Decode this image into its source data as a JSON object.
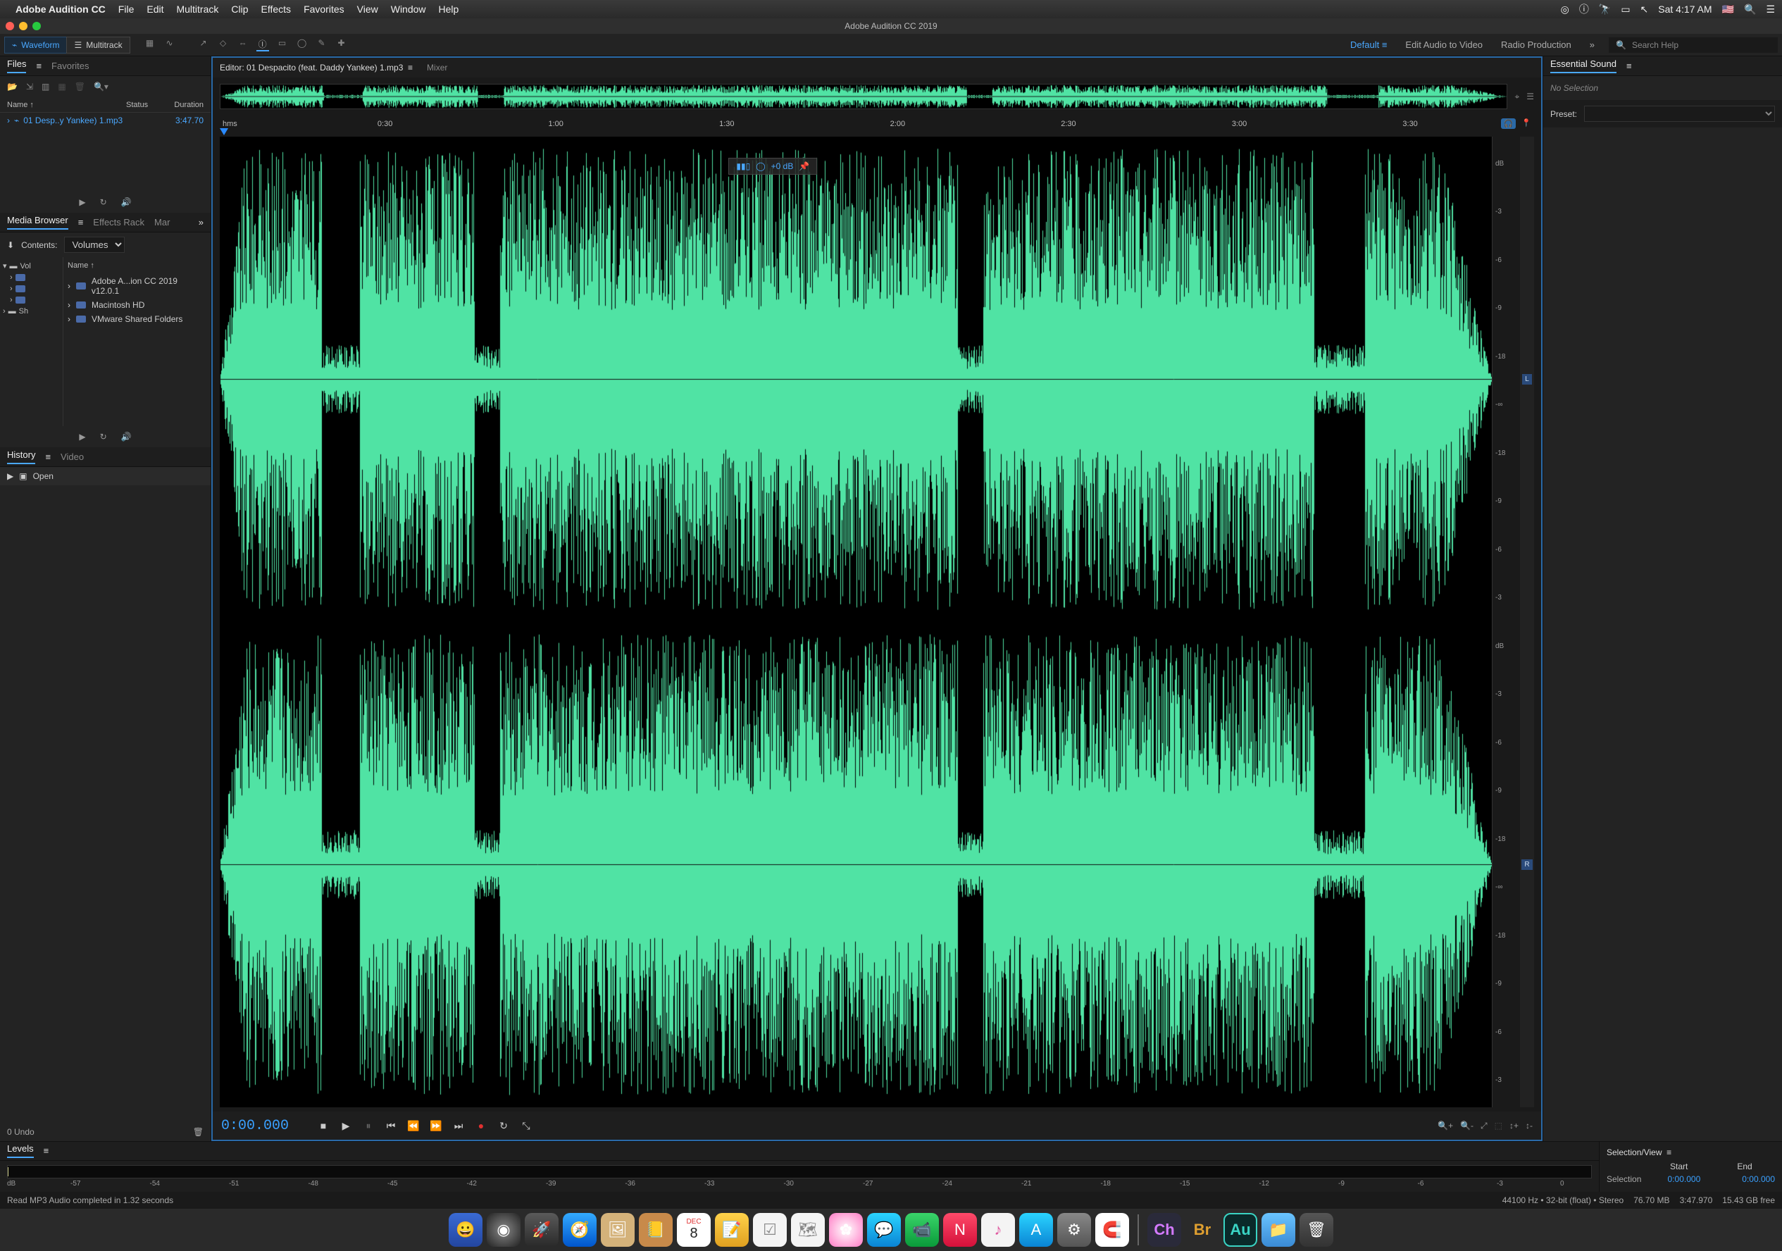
{
  "menubar": {
    "appname": "Adobe Audition CC",
    "items": [
      "File",
      "Edit",
      "Multitrack",
      "Clip",
      "Effects",
      "Favorites",
      "View",
      "Window",
      "Help"
    ],
    "clock": "Sat 4:17 AM"
  },
  "window": {
    "title": "Adobe Audition CC 2019"
  },
  "toolbar": {
    "waveform": "Waveform",
    "multitrack": "Multitrack",
    "workspaces": {
      "default": "Default",
      "edit_av": "Edit Audio to Video",
      "radio": "Radio Production"
    },
    "search_placeholder": "Search Help"
  },
  "files_panel": {
    "tab_files": "Files",
    "tab_fav": "Favorites",
    "cols": {
      "name": "Name ↑",
      "status": "Status",
      "duration": "Duration"
    },
    "rows": [
      {
        "name": "01 Desp..y Yankee) 1.mp3",
        "duration": "3:47.70"
      }
    ]
  },
  "media_browser": {
    "tab_mb": "Media Browser",
    "tab_fx": "Effects Rack",
    "tab_mar": "Mar",
    "contents_label": "Contents:",
    "contents_value": "Volumes",
    "tree_root": "Vol",
    "tree_sh": "Sh",
    "list_hdr": "Name ↑",
    "items": [
      "Adobe A...ion CC 2019 v12.0.1",
      "Macintosh HD",
      "VMware Shared Folders"
    ]
  },
  "history": {
    "tab_history": "History",
    "tab_video": "Video",
    "open": "Open",
    "undo": "0 Undo"
  },
  "editor": {
    "tab_editor": "Editor: 01 Despacito (feat. Daddy Yankee) 1.mp3",
    "tab_mixer": "Mixer",
    "hud_gain": "+0 dB",
    "timeline_hms": "hms",
    "timeline_ticks": [
      "0:30",
      "1:00",
      "1:30",
      "2:00",
      "2:30",
      "3:00",
      "3:30"
    ],
    "db_marks": [
      "dB",
      "-3",
      "-6",
      "-9",
      "-18",
      "-∞",
      "-18",
      "-9",
      "-6",
      "-3"
    ],
    "ch_left": "L",
    "ch_right": "R",
    "timecode": "0:00.000"
  },
  "essential_sound": {
    "title": "Essential Sound",
    "nosel": "No Selection",
    "preset_label": "Preset:"
  },
  "levels": {
    "title": "Levels",
    "db_label": "dB",
    "ticks": [
      "-57",
      "-54",
      "-51",
      "-48",
      "-45",
      "-42",
      "-39",
      "-36",
      "-33",
      "-30",
      "-27",
      "-24",
      "-21",
      "-18",
      "-15",
      "-12",
      "-9",
      "-6",
      "-3",
      "0"
    ]
  },
  "selview": {
    "title": "Selection/View",
    "start": "Start",
    "end": "End",
    "sel": "Selection",
    "sel_start": "0:00.000",
    "sel_end": "0:00.000"
  },
  "status": {
    "left": "Read MP3 Audio completed in 1.32 seconds",
    "sr": "44100 Hz • 32-bit (float) • Stereo",
    "size": "76.70 MB",
    "dur": "3:47.970",
    "free": "15.43 GB free"
  },
  "dock": {
    "cal_month": "DEC",
    "cal_day": "8",
    "ch": "Ch",
    "br": "Br",
    "au": "Au"
  }
}
